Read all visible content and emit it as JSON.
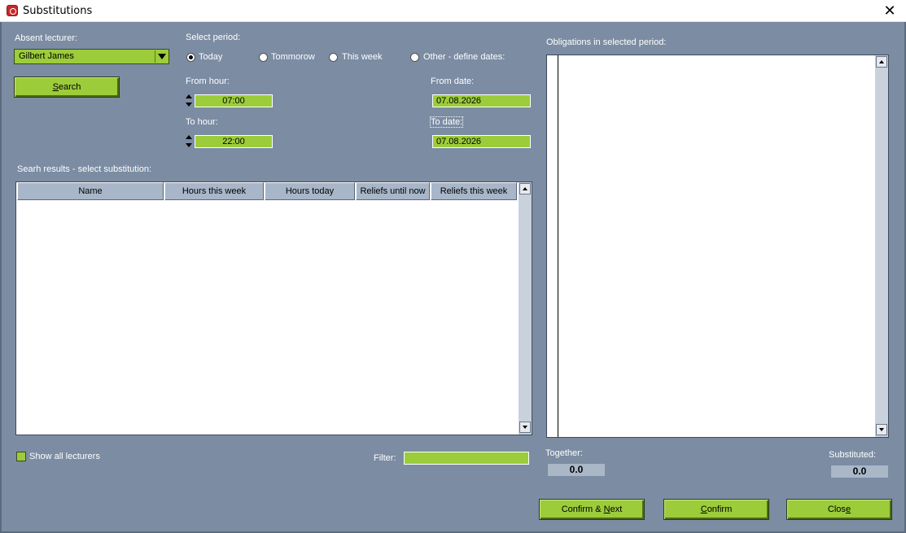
{
  "window": {
    "title": "Substitutions",
    "close_glyph": "✕",
    "app_icon": "app-icon",
    "close_icon": "close-icon"
  },
  "colors": {
    "background": "#7b8ca3",
    "accent_green": "#9ccc3a",
    "header": "#a7b6c8",
    "panel": "#ffffff"
  },
  "absent": {
    "label": "Absent lecturer:",
    "selected": "Gilbert James"
  },
  "search_button": {
    "label_pre": "",
    "label_u": "S",
    "label_post": "earch"
  },
  "period": {
    "label": "Select period:",
    "options": [
      {
        "label": "Today",
        "checked": true
      },
      {
        "label": "Tommorow",
        "checked": false
      },
      {
        "label": "This week",
        "checked": false
      },
      {
        "label": "Other - define dates:",
        "checked": false
      }
    ]
  },
  "hours": {
    "from_label": "From hour:",
    "from_value": "07:00",
    "to_label": "To hour:",
    "to_value": "22:00"
  },
  "dates": {
    "from_label": "From date:",
    "from_value": "07.08.2026",
    "to_label": "To date:",
    "to_value": "07.08.2026"
  },
  "results": {
    "label": "Searh results - select substitution:",
    "columns": [
      "Name",
      "Hours this week",
      "Hours today",
      "Reliefs until now",
      "Reliefs this week"
    ]
  },
  "show_all": {
    "label": "Show all lecturers",
    "checked": true
  },
  "filter": {
    "label": "Filter:",
    "value": ""
  },
  "obligations": {
    "label": "Obligations in selected period:"
  },
  "totals": {
    "together_label": "Together:",
    "together_value": "0.0",
    "substituted_label": "Substituted:",
    "substituted_value": "0.0"
  },
  "buttons": {
    "confirm_next": {
      "pre": "Confirm & ",
      "u": "N",
      "post": "ext"
    },
    "confirm": {
      "pre": "",
      "u": "C",
      "post": "onfirm"
    },
    "close": {
      "pre": "Clos",
      "u": "e",
      "post": ""
    }
  }
}
